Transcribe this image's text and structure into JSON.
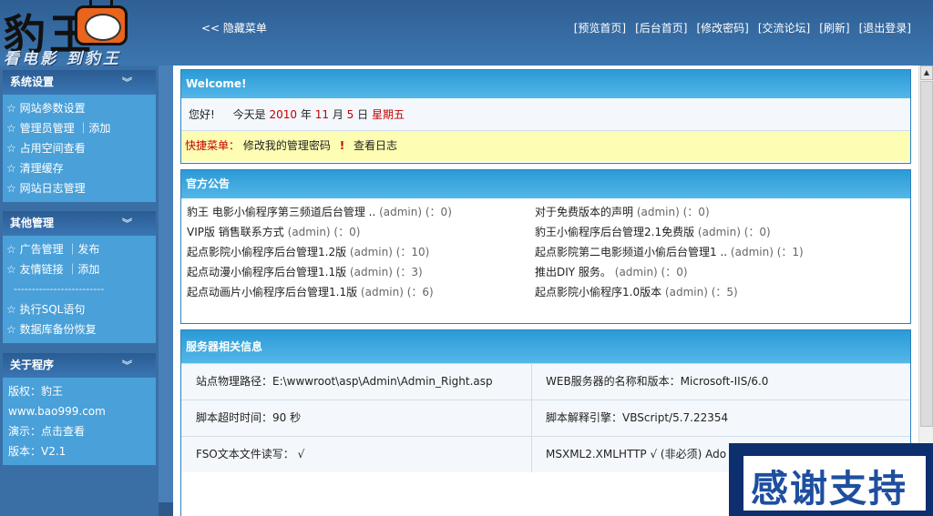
{
  "logo": {
    "title": "豹王",
    "subtitle": "看电影 到豹王"
  },
  "header": {
    "hide_menu": "<< 隐藏菜单",
    "links": [
      "[预览首页]",
      "[后台首页]",
      "[修改密码]",
      "[交流论坛]",
      "[刷新]",
      "[退出登录]"
    ]
  },
  "sidebar": {
    "sections": [
      {
        "title": "系统设置",
        "items": [
          "☆ 网站参数设置",
          "☆ 管理员管理 ｜添加",
          "☆ 占用空间查看",
          "☆ 清理缓存",
          "☆ 网站日志管理"
        ]
      },
      {
        "title": "其他管理",
        "items": [
          "☆ 广告管理 ｜发布",
          "☆ 友情链接 ｜添加",
          "☆ 执行SQL语句",
          "☆ 数据库备份恢复"
        ],
        "separator": "-------------------------"
      },
      {
        "title": "关于程序",
        "items": [
          "版权：豹王",
          "www.bao999.com",
          "演示：点击查看",
          "版本：V2.1"
        ]
      }
    ]
  },
  "welcome": {
    "title": "Welcome!",
    "greeting": "您好!",
    "today_prefix": "今天是",
    "year": "2010",
    "year_unit": "年",
    "month": "11",
    "month_unit": "月",
    "day": "5",
    "day_unit": "日",
    "weekday": "星期五",
    "quick_label": "快捷菜单：",
    "quick_links": [
      "修改我的管理密码",
      "查看日志"
    ]
  },
  "notice": {
    "title": "官方公告",
    "left": [
      {
        "text": "豹王 电影小偷程序第三频道后台管理 ..",
        "meta": "(admin) (：0)"
      },
      {
        "text": "VIP版 销售联系方式",
        "meta": "(admin) (：0)"
      },
      {
        "text": "起点影院小偷程序后台管理1.2版",
        "meta": "(admin) (：10)"
      },
      {
        "text": "起点动漫小偷程序后台管理1.1版",
        "meta": "(admin) (：3)"
      },
      {
        "text": "起点动画片小偷程序后台管理1.1版",
        "meta": "(admin) (：6)"
      }
    ],
    "right": [
      {
        "text": "对于免费版本的声明",
        "meta": "(admin) (：0)"
      },
      {
        "text": "豹王小偷程序后台管理2.1免费版",
        "meta": "(admin) (：0)"
      },
      {
        "text": "起点影院第二电影频道小偷后台管理1 ..",
        "meta": "(admin) (：1)"
      },
      {
        "text": "推出DIY 服务。",
        "meta": "(admin) (：0)"
      },
      {
        "text": "起点影院小偷程序1.0版本",
        "meta": "(admin) (：5)"
      }
    ]
  },
  "server": {
    "title": "服务器相关信息",
    "rows": [
      [
        "站点物理路径：E:\\wwwroot\\asp\\Admin\\Admin_Right.asp",
        "WEB服务器的名称和版本：Microsoft-IIS/6.0"
      ],
      [
        "脚本超时时间：90 秒",
        "脚本解释引擎：VBScript/5.7.22354"
      ],
      [
        "FSO文本文件读写： √",
        "MSXML2.XMLHTTP √ (非必须)    Ado"
      ]
    ]
  },
  "banner": {
    "text": "感谢支持"
  },
  "colors": {
    "accent": "#2b9ad6",
    "sidebar": "#4aa0d8",
    "header": "#3a6fa6",
    "red": "#c40000"
  }
}
